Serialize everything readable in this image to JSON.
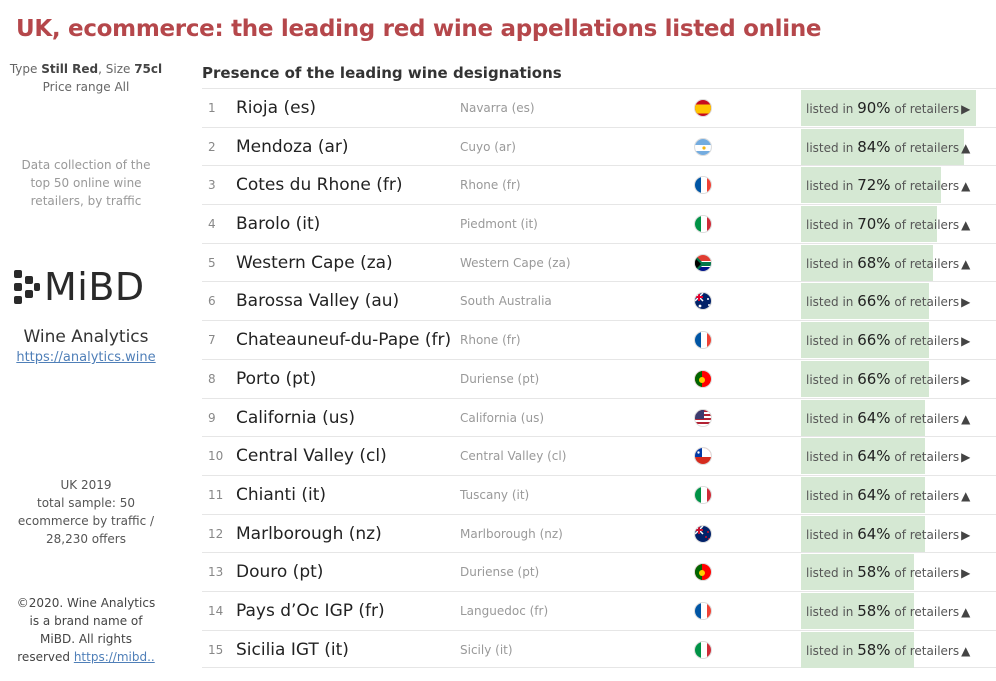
{
  "header": {
    "title": "UK, ecommerce: the leading red wine appellations listed online",
    "subtitle": "Presence of the leading wine designations"
  },
  "sidebar": {
    "filter_prefix_type": "Type",
    "filter_type": "Still Red",
    "filter_prefix_size": ", Size",
    "filter_size": "75cl",
    "filter_line2": "Price range All",
    "collection_line1": "Data collection of the",
    "collection_line2": "top 50 online  wine",
    "collection_line3": "retailers, by traffic",
    "logo_text": "MiBD",
    "brand": "Wine Analytics",
    "url": "https://analytics.wine",
    "sample_line1": "UK 2019",
    "sample_line2": "total sample: 50",
    "sample_line3": "ecommerce by traffic  /",
    "sample_line4": "28,230 offers",
    "footer_line1": "©2020. Wine Analytics",
    "footer_line2": "is a brand name of",
    "footer_line3": "MiBD. All rights",
    "footer_line4_prefix": "reserved",
    "footer_link": "https://mibd.."
  },
  "labels": {
    "listed_in": "listed in",
    "of_retailers": "of retailers"
  },
  "rows": [
    {
      "rank": "1",
      "name": "Rioja (es)",
      "region": "Navarra (es)",
      "flag": "es",
      "pct": 90,
      "pct_label": "90%",
      "trend": "right",
      "arrow": "▶"
    },
    {
      "rank": "2",
      "name": "Mendoza (ar)",
      "region": "Cuyo (ar)",
      "flag": "ar",
      "pct": 84,
      "pct_label": "84%",
      "trend": "up",
      "arrow": "▲"
    },
    {
      "rank": "3",
      "name": "Cotes du Rhone (fr)",
      "region": "Rhone (fr)",
      "flag": "fr",
      "pct": 72,
      "pct_label": "72%",
      "trend": "up",
      "arrow": "▲"
    },
    {
      "rank": "4",
      "name": "Barolo (it)",
      "region": "Piedmont (it)",
      "flag": "it",
      "pct": 70,
      "pct_label": "70%",
      "trend": "up",
      "arrow": "▲"
    },
    {
      "rank": "5",
      "name": "Western Cape (za)",
      "region": "Western Cape (za)",
      "flag": "za",
      "pct": 68,
      "pct_label": "68%",
      "trend": "up",
      "arrow": "▲"
    },
    {
      "rank": "6",
      "name": "Barossa Valley (au)",
      "region": "South Australia",
      "flag": "au",
      "pct": 66,
      "pct_label": "66%",
      "trend": "right",
      "arrow": "▶"
    },
    {
      "rank": "7",
      "name": "Chateauneuf-du-Pape (fr)",
      "region": "Rhone (fr)",
      "flag": "fr",
      "pct": 66,
      "pct_label": "66%",
      "trend": "right",
      "arrow": "▶"
    },
    {
      "rank": "8",
      "name": "Porto (pt)",
      "region": "Duriense (pt)",
      "flag": "pt",
      "pct": 66,
      "pct_label": "66%",
      "trend": "right",
      "arrow": "▶"
    },
    {
      "rank": "9",
      "name": "California (us)",
      "region": "California (us)",
      "flag": "us",
      "pct": 64,
      "pct_label": "64%",
      "trend": "up",
      "arrow": "▲"
    },
    {
      "rank": "10",
      "name": "Central Valley (cl)",
      "region": "Central Valley (cl)",
      "flag": "cl",
      "pct": 64,
      "pct_label": "64%",
      "trend": "right",
      "arrow": "▶"
    },
    {
      "rank": "11",
      "name": "Chianti (it)",
      "region": "Tuscany (it)",
      "flag": "it",
      "pct": 64,
      "pct_label": "64%",
      "trend": "up",
      "arrow": "▲"
    },
    {
      "rank": "12",
      "name": "Marlborough (nz)",
      "region": "Marlborough (nz)",
      "flag": "nz",
      "pct": 64,
      "pct_label": "64%",
      "trend": "right",
      "arrow": "▶"
    },
    {
      "rank": "13",
      "name": "Douro (pt)",
      "region": "Duriense (pt)",
      "flag": "pt",
      "pct": 58,
      "pct_label": "58%",
      "trend": "right",
      "arrow": "▶"
    },
    {
      "rank": "14",
      "name": "Pays d’Oc IGP (fr)",
      "region": "Languedoc (fr)",
      "flag": "fr",
      "pct": 58,
      "pct_label": "58%",
      "trend": "up",
      "arrow": "▲"
    },
    {
      "rank": "15",
      "name": "Sicilia IGT (it)",
      "region": "Sicily (it)",
      "flag": "it",
      "pct": 58,
      "pct_label": "58%",
      "trend": "up",
      "arrow": "▲"
    }
  ],
  "colors": {
    "title": "#b5474b",
    "bar": "#d5e8d3",
    "link": "#4f7fb8"
  }
}
